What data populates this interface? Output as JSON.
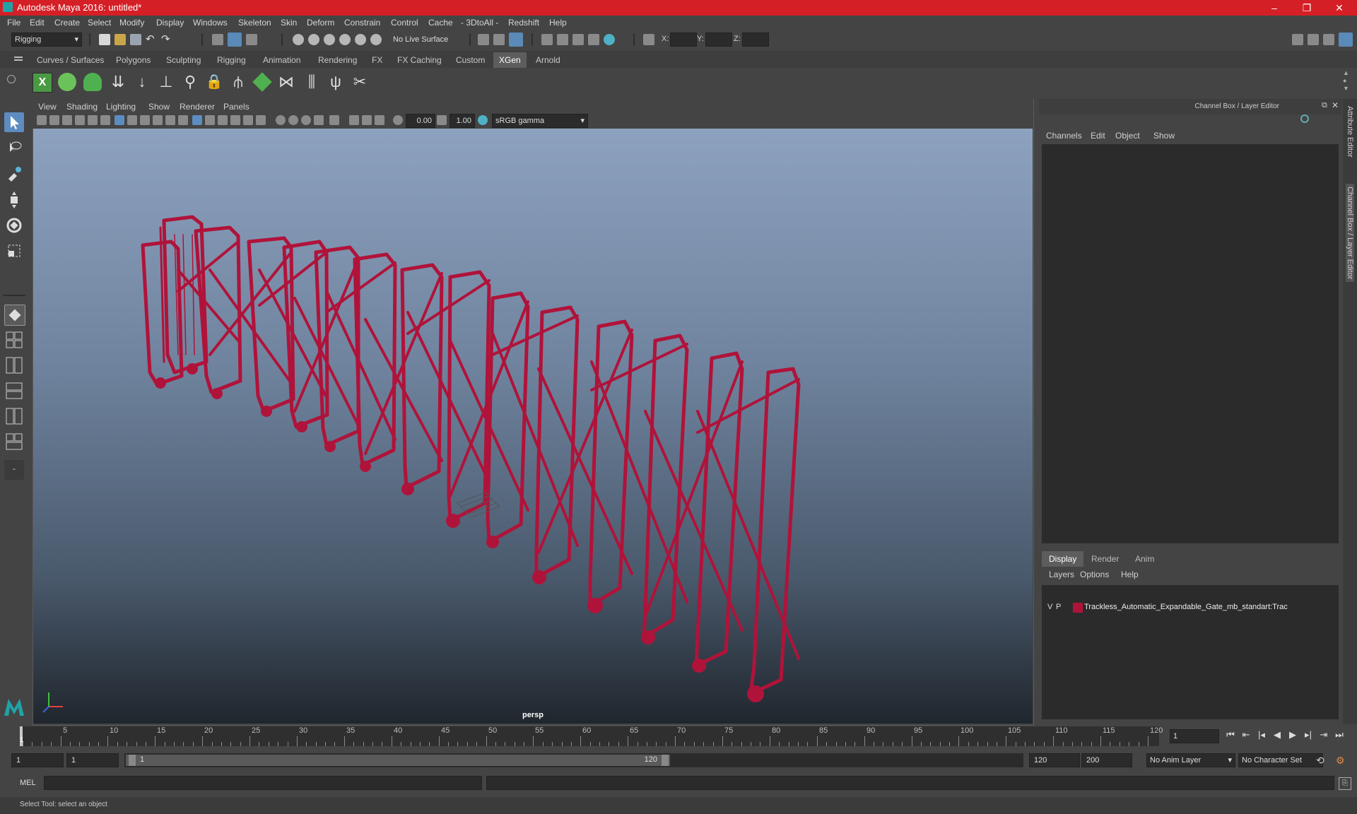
{
  "window": {
    "title": "Autodesk Maya 2016: untitled*"
  },
  "menu": [
    "File",
    "Edit",
    "Create",
    "Select",
    "Modify",
    "Display",
    "Windows",
    "Skeleton",
    "Skin",
    "Deform",
    "Constrain",
    "Control",
    "Cache",
    "- 3DtoAll -",
    "Redshift",
    "Help"
  ],
  "statusline": {
    "mode": "Rigging",
    "live_surface": "No Live Surface",
    "x_label": "X:",
    "y_label": "Y:",
    "z_label": "Z:"
  },
  "shelf_tabs": [
    "Curves / Surfaces",
    "Polygons",
    "Sculpting",
    "Rigging",
    "Animation",
    "Rendering",
    "FX",
    "FX Caching",
    "Custom",
    "XGen",
    "Arnold"
  ],
  "shelf_active": "XGen",
  "viewport": {
    "menu": [
      "View",
      "Shading",
      "Lighting",
      "Show",
      "Renderer",
      "Panels"
    ],
    "exposure": "0.00",
    "gamma": "1.00",
    "color_space": "sRGB gamma",
    "camera": "persp"
  },
  "channel_box": {
    "title": "Channel Box / Layer Editor",
    "menu": [
      "Channels",
      "Edit",
      "Object",
      "Show"
    ]
  },
  "layer_editor": {
    "tabs": [
      "Display",
      "Render",
      "Anim"
    ],
    "active_tab": "Display",
    "menu": [
      "Layers",
      "Options",
      "Help"
    ],
    "layer": {
      "v": "V",
      "p": "P",
      "name": "Trackless_Automatic_Expandable_Gate_mb_standart:Trac",
      "color": "#b0133a"
    }
  },
  "side_tabs": [
    "Attribute Editor",
    "Channel Box / Layer Editor"
  ],
  "timeline": {
    "ticks": [
      5,
      10,
      15,
      20,
      25,
      30,
      35,
      40,
      45,
      50,
      55,
      60,
      65,
      70,
      75,
      80,
      85,
      90,
      95,
      100,
      105,
      110,
      115,
      120
    ],
    "current_frame_marker": "1",
    "current_frame": "1"
  },
  "range": {
    "start": "1",
    "playback_start": "1",
    "slider_start": "1",
    "slider_end": "120",
    "playback_end": "120",
    "end": "200",
    "anim_layer": "No Anim Layer",
    "character_set": "No Character Set"
  },
  "command": {
    "lang": "MEL"
  },
  "help_line": "Select Tool: select an object",
  "colors": {
    "title_bar": "#d51f26",
    "model": "#b0133a",
    "accent": "#1fa3a8"
  }
}
